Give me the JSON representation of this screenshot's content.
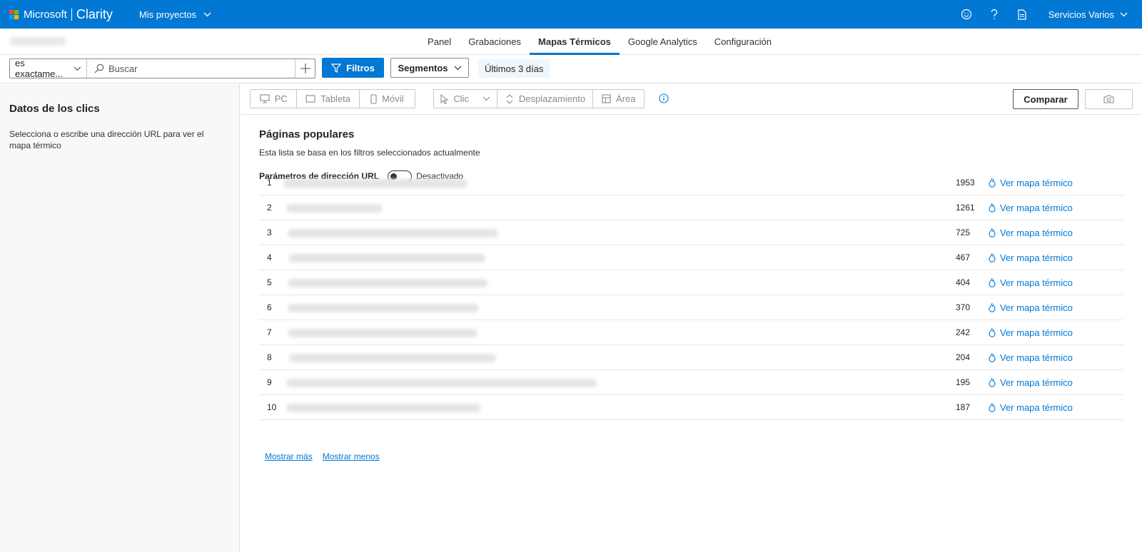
{
  "header": {
    "brand_ms": "Microsoft",
    "brand_app": "Clarity",
    "project_menu": "Mis proyectos",
    "account": "Servicios Varios",
    "icons": [
      "smiley-icon",
      "help-icon",
      "document-icon"
    ],
    "color": "#0078d4"
  },
  "nav": {
    "tabs": [
      {
        "label": "Panel"
      },
      {
        "label": "Grabaciones"
      },
      {
        "label": "Mapas Térmicos",
        "active": true
      },
      {
        "label": "Google Analytics"
      },
      {
        "label": "Configuración"
      }
    ]
  },
  "filterbar": {
    "match_select": "es exactame...",
    "search_placeholder": "Buscar",
    "filters_label": "Filtros",
    "segments_label": "Segmentos",
    "date_range": "Últimos 3 días"
  },
  "sidebar": {
    "title": "Datos de los clics",
    "text": "Selecciona o escribe una dirección URL para ver el mapa térmico"
  },
  "toolbar": {
    "devices": [
      "PC",
      "Tableta",
      "Móvil"
    ],
    "modes": [
      "Clic",
      "Desplazamiento",
      "Área"
    ],
    "compare_label": "Comparar"
  },
  "popular": {
    "title": "Páginas populares",
    "subtitle": "Esta lista se basa en los filtros seleccionados actualmente",
    "param_label": "Parámetros de dirección URL",
    "param_state": "Desactivado",
    "param_enabled": false,
    "link_label": "Ver mapa térmico",
    "rows": [
      {
        "rank": "1",
        "count": "1953"
      },
      {
        "rank": "2",
        "count": "1261"
      },
      {
        "rank": "3",
        "count": "725"
      },
      {
        "rank": "4",
        "count": "467"
      },
      {
        "rank": "5",
        "count": "404"
      },
      {
        "rank": "6",
        "count": "370"
      },
      {
        "rank": "7",
        "count": "242"
      },
      {
        "rank": "8",
        "count": "204"
      },
      {
        "rank": "9",
        "count": "195"
      },
      {
        "rank": "10",
        "count": "187"
      }
    ],
    "show_more": "Mostrar más",
    "show_less": "Mostrar menos"
  }
}
